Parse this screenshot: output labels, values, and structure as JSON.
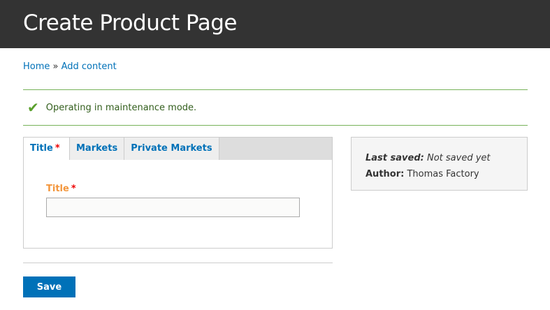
{
  "header": {
    "title": "Create Product Page"
  },
  "breadcrumb": {
    "home": "Home",
    "sep": " » ",
    "current": "Add content"
  },
  "message": {
    "text": "Operating in maintenance mode."
  },
  "tabs": [
    {
      "label": "Title",
      "required": "*"
    },
    {
      "label": "Markets"
    },
    {
      "label": "Private Markets"
    }
  ],
  "form": {
    "title_label": "Title",
    "required": "*",
    "title_value": ""
  },
  "meta": {
    "last_saved_label": "Last saved:",
    "last_saved_value": " Not saved yet",
    "author_label": "Author:",
    "author_value": " Thomas Factory"
  },
  "actions": {
    "save": "Save"
  }
}
